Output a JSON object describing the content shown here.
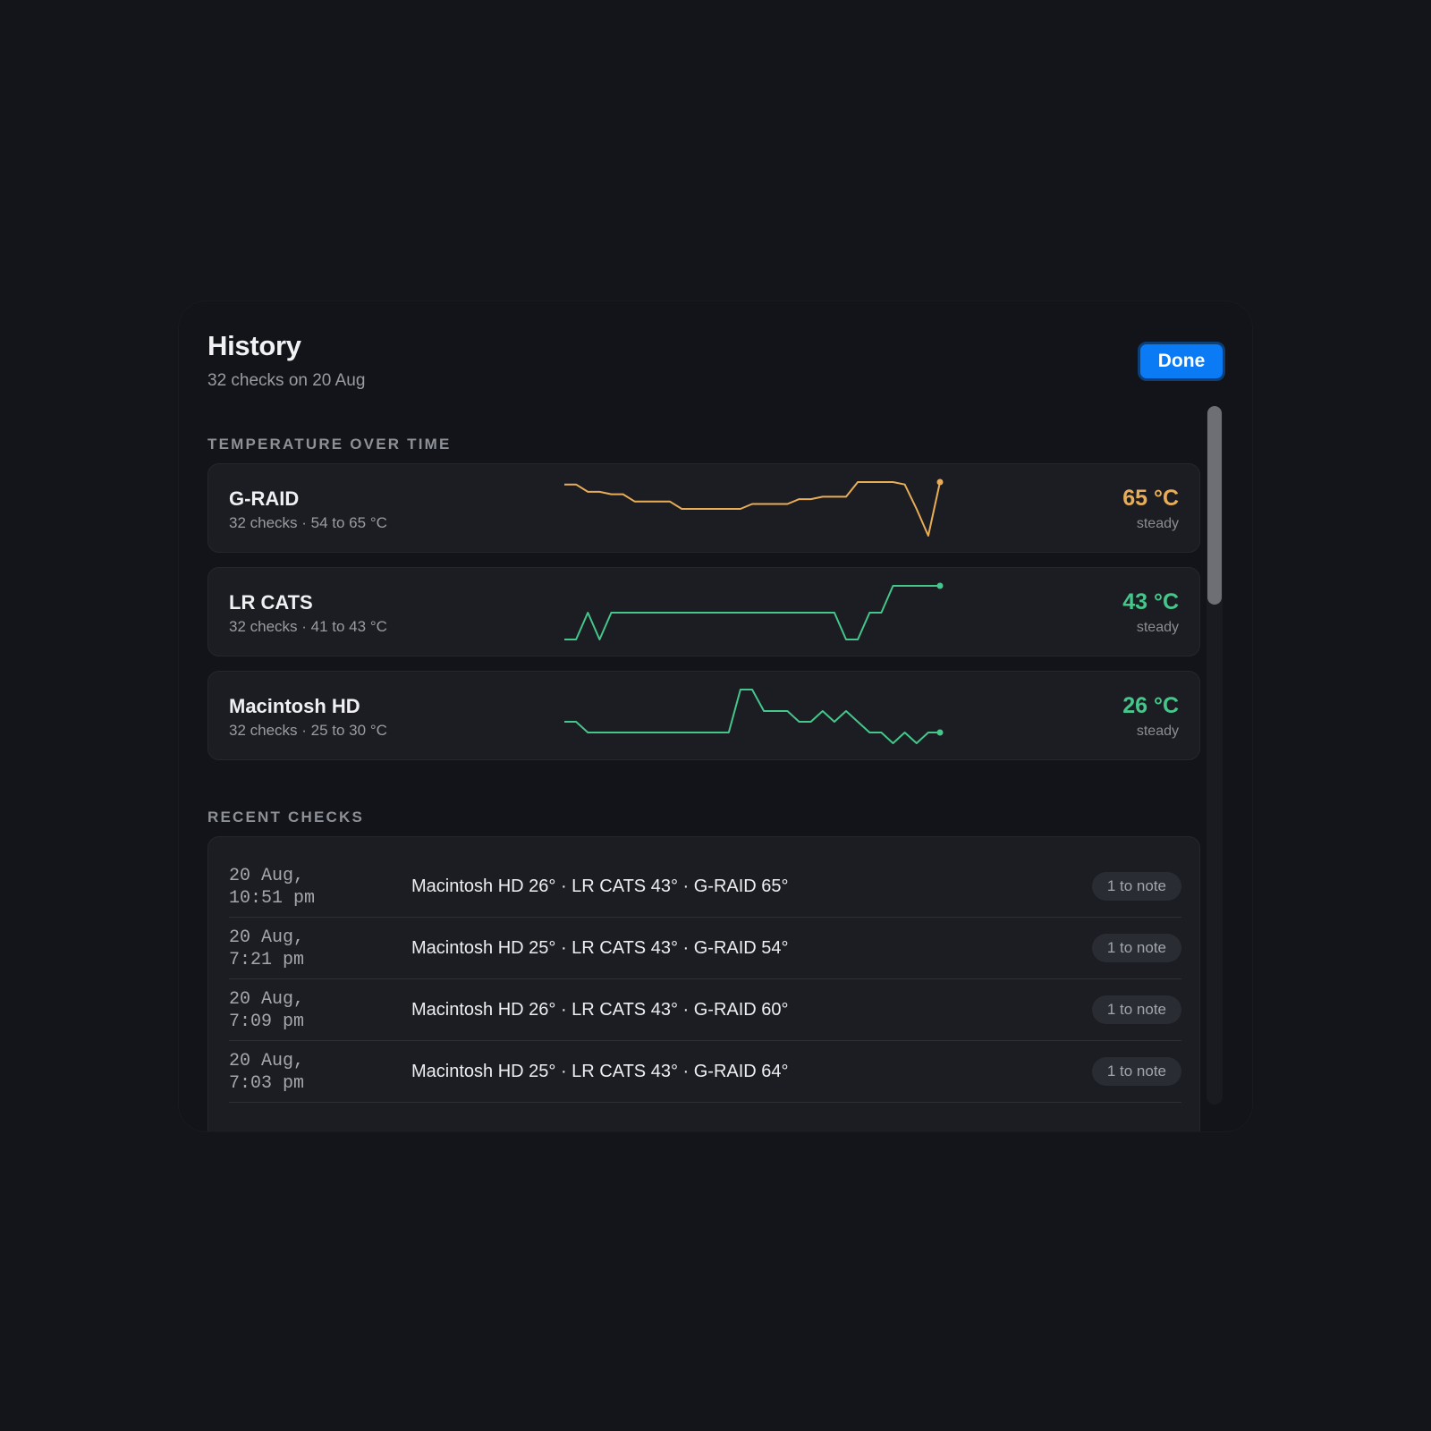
{
  "sheet": {
    "title": "History",
    "subtitle": "32 checks on 20 Aug",
    "done_label": "Done"
  },
  "temperature": {
    "section_label": "TEMPERATURE OVER TIME",
    "drives": [
      {
        "name": "G-RAID",
        "meta": "32 checks · 54 to 65 °C",
        "temp": "65 °C",
        "trend": "steady",
        "color": "#e9ad57",
        "min": 54,
        "max": 65,
        "series": [
          64.5,
          64.5,
          63,
          63,
          62.5,
          62.5,
          61,
          61,
          61,
          61,
          59.5,
          59.5,
          59.5,
          59.5,
          59.5,
          59.5,
          60.5,
          60.5,
          60.5,
          60.5,
          61.5,
          61.5,
          62,
          62,
          62,
          65,
          65,
          65,
          65,
          64.5,
          59.5,
          54,
          65
        ]
      },
      {
        "name": "LR CATS",
        "meta": "32 checks · 41 to 43 °C",
        "temp": "43 °C",
        "trend": "steady",
        "color": "#45c68a",
        "min": 41,
        "max": 43,
        "series": [
          41,
          41,
          42,
          41,
          42,
          42,
          42,
          42,
          42,
          42,
          42,
          42,
          42,
          42,
          42,
          42,
          42,
          42,
          42,
          42,
          42,
          42,
          42,
          42,
          41,
          41,
          42,
          42,
          43,
          43,
          43,
          43,
          43
        ]
      },
      {
        "name": "Macintosh HD",
        "meta": "32 checks · 25 to 30 °C",
        "temp": "26 °C",
        "trend": "steady",
        "color": "#45c68a",
        "min": 25,
        "max": 30,
        "series": [
          27,
          27,
          26,
          26,
          26,
          26,
          26,
          26,
          26,
          26,
          26,
          26,
          26,
          26,
          26,
          30,
          30,
          28,
          28,
          28,
          27,
          27,
          28,
          27,
          28,
          27,
          26,
          26,
          25,
          26,
          25,
          26,
          26
        ]
      }
    ]
  },
  "recent": {
    "section_label": "RECENT CHECKS",
    "rows": [
      {
        "time": "20 Aug,\n10:51 pm",
        "summary": "Macintosh HD 26° · LR CATS 43° · G-RAID 65°",
        "badge": "1 to note"
      },
      {
        "time": "20 Aug,\n7:21 pm",
        "summary": "Macintosh HD 25° · LR CATS 43° · G-RAID 54°",
        "badge": "1 to note"
      },
      {
        "time": "20 Aug,\n7:09 pm",
        "summary": "Macintosh HD 26° · LR CATS 43° · G-RAID 60°",
        "badge": "1 to note"
      },
      {
        "time": "20 Aug,\n7:03 pm",
        "summary": "Macintosh HD 25° · LR CATS 43° · G-RAID 64°",
        "badge": "1 to note"
      }
    ]
  }
}
